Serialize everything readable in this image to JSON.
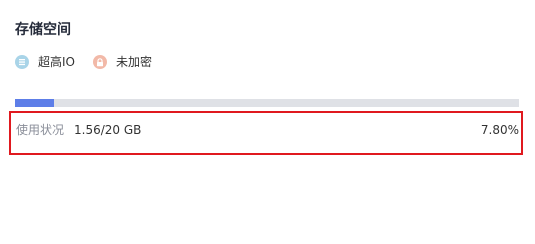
{
  "storage": {
    "title": "存储空间",
    "tags": [
      {
        "label": "超高IO",
        "icon": "disk-icon",
        "color": "#a9d4e8"
      },
      {
        "label": "未加密",
        "icon": "lock-icon",
        "color": "#f2b9a8"
      }
    ],
    "usage": {
      "label": "使用状况",
      "value": "1.56/20 GB",
      "percent": "7.80%",
      "fraction": 0.078
    },
    "colors": {
      "bar_fill": "#5d7ee8",
      "bar_track": "#dfe1e6",
      "highlight_border": "#e0191f"
    }
  }
}
